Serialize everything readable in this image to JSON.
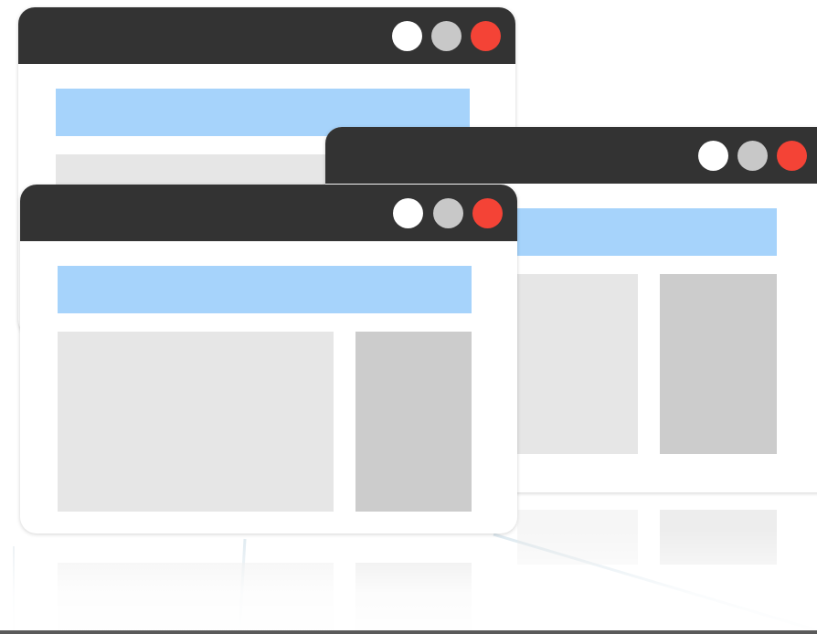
{
  "illustration": {
    "windows": [
      {
        "id": "back-top-left",
        "titlebar_color": "#333333",
        "controls": [
          "window-button-white",
          "window-button-gray",
          "window-button-red"
        ]
      },
      {
        "id": "back-right",
        "titlebar_color": "#333333",
        "controls": [
          "window-button-white",
          "window-button-gray",
          "window-button-red"
        ]
      },
      {
        "id": "front",
        "titlebar_color": "#333333",
        "controls": [
          "window-button-white",
          "window-button-gray",
          "window-button-red"
        ]
      }
    ],
    "colors": {
      "titlebar": "#333333",
      "header_block": "#a6d3fb",
      "content_light": "#e6e6e6",
      "content_mid": "#cccccc",
      "button_white": "#ffffff",
      "button_gray": "#c8c8c8",
      "button_red": "#f44336",
      "background": "#ffffff"
    }
  }
}
